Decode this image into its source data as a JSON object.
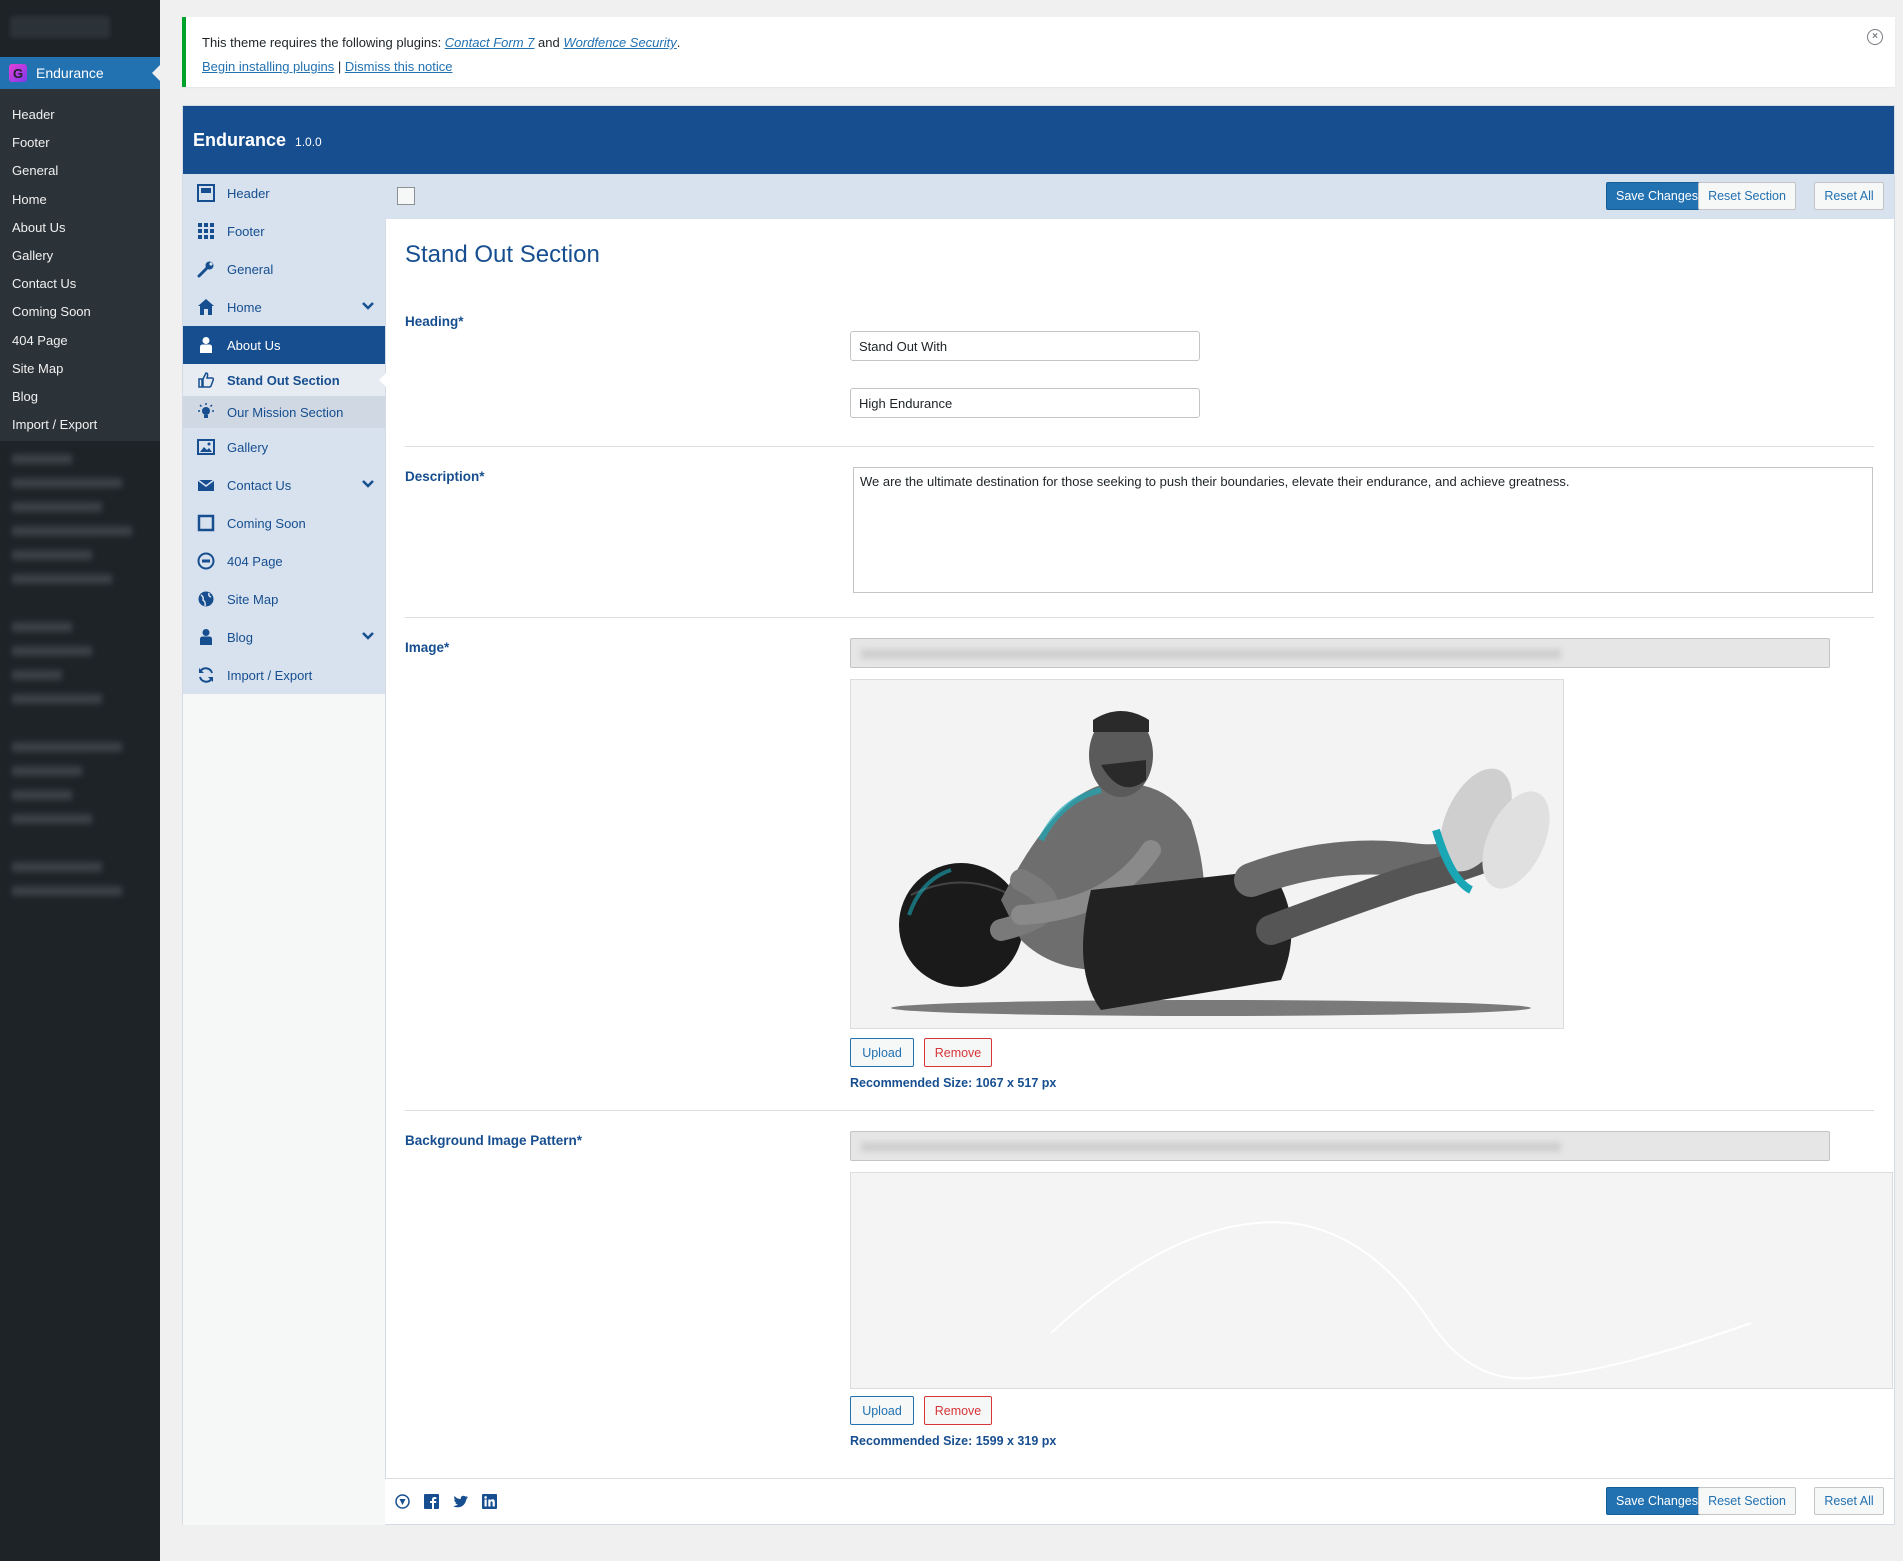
{
  "wp_menu": {
    "active_label": "Endurance",
    "sub_items": [
      "Header",
      "Footer",
      "General",
      "Home",
      "About Us",
      "Gallery",
      "Contact Us",
      "Coming Soon",
      "404 Page",
      "Site Map",
      "Blog",
      "Import / Export"
    ]
  },
  "notice": {
    "text_before": "This theme requires the following plugins: ",
    "plugin1": "Contact Form 7",
    "and": " and ",
    "plugin2": "Wordfence Security",
    "period": ".",
    "install_link": "Begin installing plugins",
    "separator": " | ",
    "dismiss_link": "Dismiss this notice"
  },
  "panel": {
    "title": "Endurance",
    "version": "1.0.0"
  },
  "nav": {
    "items": [
      {
        "label": "Header",
        "icon": "header-icon"
      },
      {
        "label": "Footer",
        "icon": "grid-icon"
      },
      {
        "label": "General",
        "icon": "wrench-icon"
      },
      {
        "label": "Home",
        "icon": "home-icon"
      },
      {
        "label": "About Us",
        "icon": "person-icon"
      },
      {
        "label": "Gallery",
        "icon": "image-icon"
      },
      {
        "label": "Contact Us",
        "icon": "envelope-icon"
      },
      {
        "label": "Coming Soon",
        "icon": "square-icon"
      },
      {
        "label": "404 Page",
        "icon": "minus-circle-icon"
      },
      {
        "label": "Site Map",
        "icon": "globe-icon"
      },
      {
        "label": "Blog",
        "icon": "person-icon"
      },
      {
        "label": "Import / Export",
        "icon": "refresh-icon"
      }
    ],
    "sub_items": [
      {
        "label": "Stand Out Section",
        "icon": "thumbs-up-icon"
      },
      {
        "label": "Our Mission Section",
        "icon": "lightbulb-icon"
      }
    ]
  },
  "toolbar": {
    "save": "Save Changes",
    "reset_section": "Reset Section",
    "reset_all": "Reset All"
  },
  "content": {
    "section_title": "Stand Out Section",
    "heading_label": "Heading*",
    "heading_value_1": "Stand Out With",
    "heading_value_2": "High Endurance",
    "description_label": "Description*",
    "description_value": "We are the ultimate destination for those seeking to push their boundaries, elevate their endurance, and achieve greatness.",
    "image_label": "Image*",
    "image_recommended": "Recommended Size: 1067 x 517 px",
    "bg_label": "Background Image Pattern*",
    "bg_recommended": "Recommended Size: 1599 x 319 px",
    "upload": "Upload",
    "remove": "Remove"
  },
  "colors": {
    "brand_blue": "#164e8f",
    "wp_blue": "#2271b1",
    "notice_green": "#00a32a",
    "remove_red": "#d63638"
  }
}
